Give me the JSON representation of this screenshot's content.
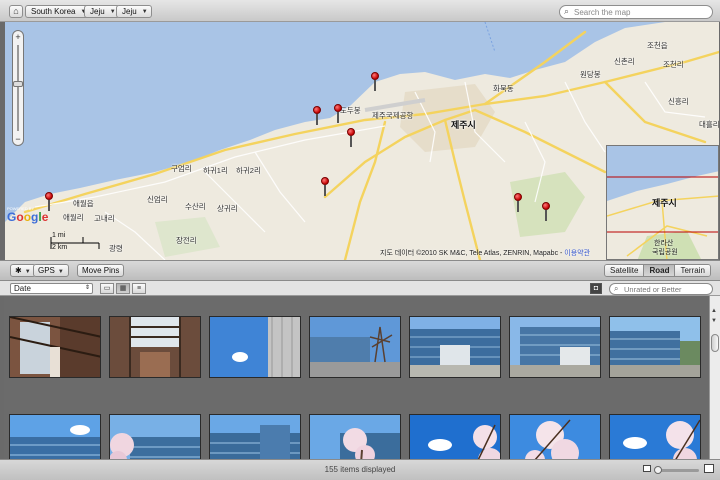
{
  "breadcrumbs": [
    {
      "label": "South Korea"
    },
    {
      "label": "Jeju"
    },
    {
      "label": "Jeju"
    }
  ],
  "search": {
    "placeholder": "Search the map",
    "value": ""
  },
  "map": {
    "place_labels": [
      {
        "text": "제주시",
        "big": true
      },
      {
        "text": "제주국제공항"
      },
      {
        "text": "화북동"
      },
      {
        "text": "조천읍"
      },
      {
        "text": "신촌리"
      },
      {
        "text": "원당봉"
      },
      {
        "text": "조천리"
      },
      {
        "text": "신흥리"
      },
      {
        "text": "대흘리"
      },
      {
        "text": "구엄리"
      },
      {
        "text": "하귀1리"
      },
      {
        "text": "하귀2리"
      },
      {
        "text": "신엄리"
      },
      {
        "text": "수산리"
      },
      {
        "text": "상귀리"
      },
      {
        "text": "애월읍"
      },
      {
        "text": "애월리"
      },
      {
        "text": "고내리"
      },
      {
        "text": "장전리"
      },
      {
        "text": "광령"
      },
      {
        "text": "도두봉"
      }
    ],
    "pin_count": 9,
    "scale": {
      "top": "1 mi",
      "bottom": "2 km"
    },
    "brand": {
      "powered": "POWERED BY",
      "logo": "Google"
    },
    "copyright": "지도 데이터 ©2010 SK M&C, Tele Atlas, ZENRIN, Mapabc - ",
    "terms": "이용약관",
    "overview_labels": [
      {
        "text": "제주시",
        "big": true
      },
      {
        "text": "한라산"
      },
      {
        "text": "국립공원"
      }
    ]
  },
  "map_controls": {
    "action_icon": "gear-icon",
    "gps_label": "GPS",
    "move_pins_label": "Move Pins",
    "map_types": [
      {
        "label": "Satellite",
        "active": false
      },
      {
        "label": "Road",
        "active": true
      },
      {
        "label": "Terrain",
        "active": false
      }
    ]
  },
  "sort": {
    "selected": "Date"
  },
  "filter": {
    "placeholder": "Unrated or Better",
    "value": ""
  },
  "photos": {
    "row1": [
      "atrium",
      "atrium",
      "sky-building",
      "campus-tree",
      "campus-building",
      "campus-building",
      "campus-building"
    ],
    "row2": [
      "building-blue",
      "building-blossom",
      "building-blue",
      "building-blossom",
      "sky-blossom",
      "sky-blossom",
      "sky-blossom"
    ]
  },
  "status": {
    "count_text": "155 items displayed",
    "thumb_zoom": 0.1
  },
  "colors": {
    "water": "#a9c4e6",
    "land": "#eeeadf",
    "road": "#f7dc6f",
    "pin": "#d00000",
    "grid_bg": "#6b6b6b"
  }
}
